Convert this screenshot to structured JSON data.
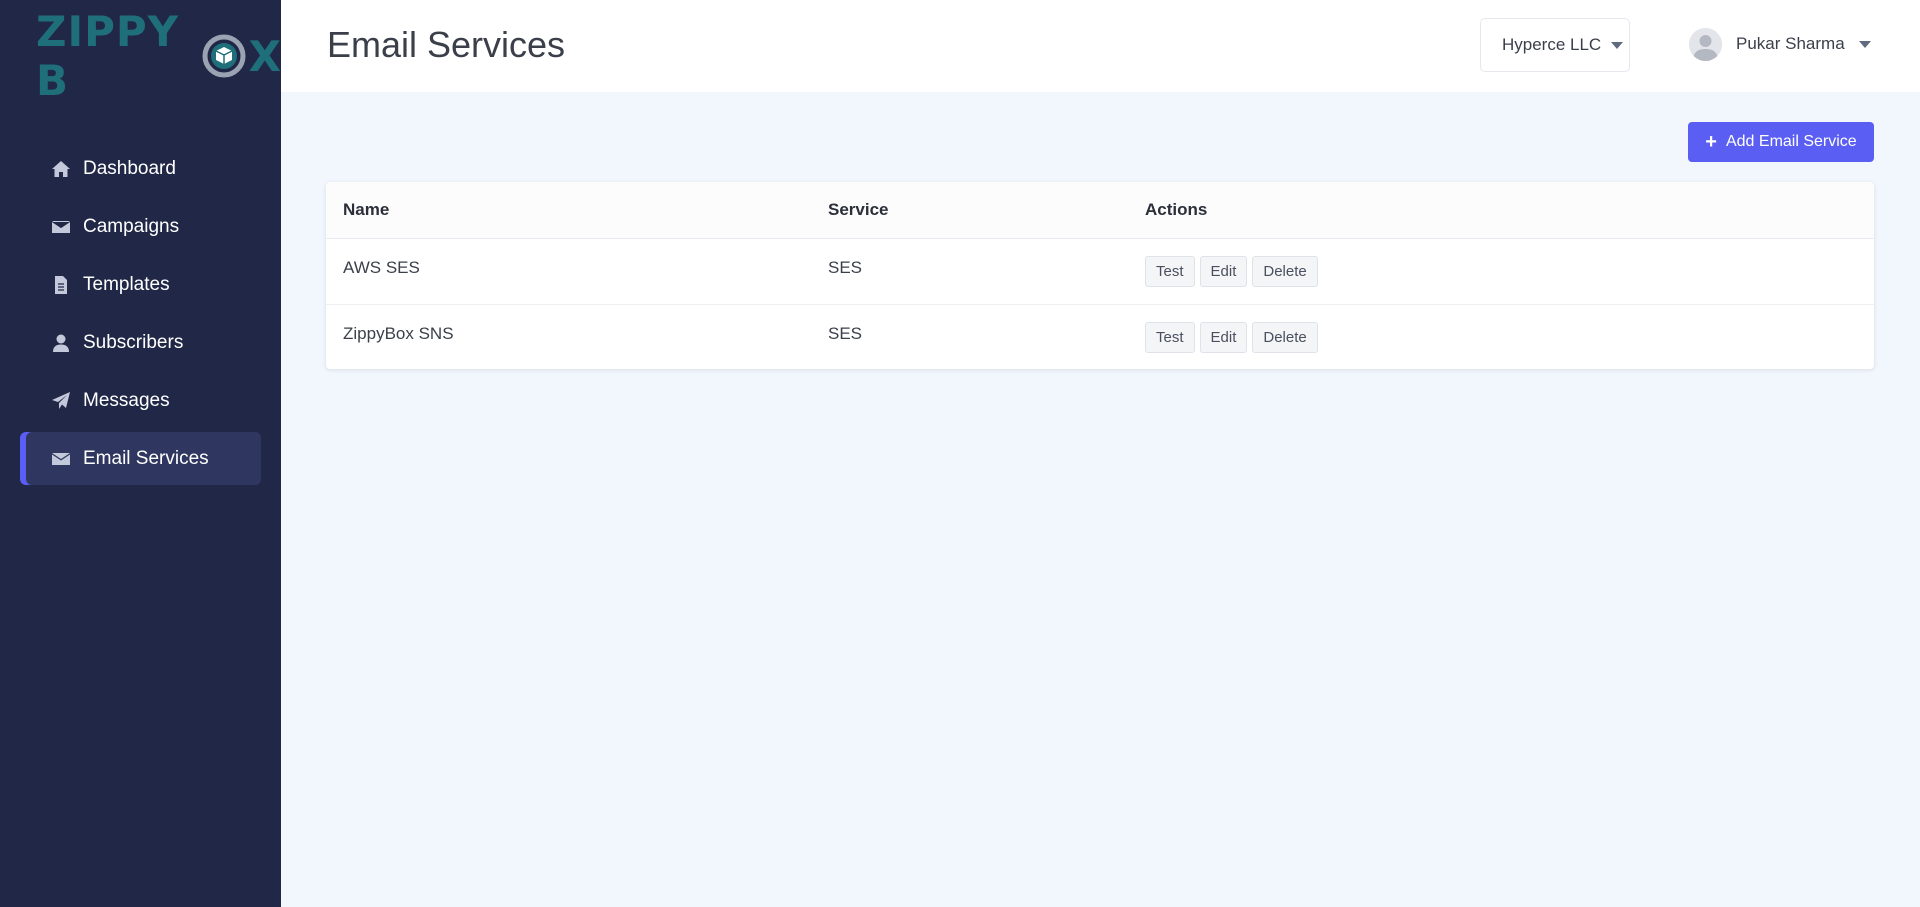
{
  "brand": {
    "logo_text_1": "ZIPPY B",
    "logo_text_2": "X",
    "logo_color": "#1f6f7a"
  },
  "sidebar": {
    "items": [
      {
        "label": "Dashboard",
        "icon": "home-icon",
        "active": false
      },
      {
        "label": "Campaigns",
        "icon": "envelope-icon",
        "active": false
      },
      {
        "label": "Templates",
        "icon": "file-icon",
        "active": false
      },
      {
        "label": "Subscribers",
        "icon": "user-icon",
        "active": false
      },
      {
        "label": "Messages",
        "icon": "paper-plane-icon",
        "active": false
      },
      {
        "label": "Email Services",
        "icon": "envelope-icon",
        "active": true
      }
    ]
  },
  "header": {
    "title": "Email Services",
    "org": "Hyperce LLC",
    "user_name": "Pukar Sharma"
  },
  "main": {
    "add_button_label": "Add Email Service",
    "table": {
      "columns": [
        "Name",
        "Service",
        "Actions"
      ],
      "rows": [
        {
          "name": "AWS SES",
          "service": "SES"
        },
        {
          "name": "ZippyBox SNS",
          "service": "SES"
        }
      ],
      "actions": [
        "Test",
        "Edit",
        "Delete"
      ]
    }
  },
  "colors": {
    "sidebar_bg": "#212746",
    "accent": "#5a5ef2",
    "page_bg": "#f2f6fd"
  }
}
